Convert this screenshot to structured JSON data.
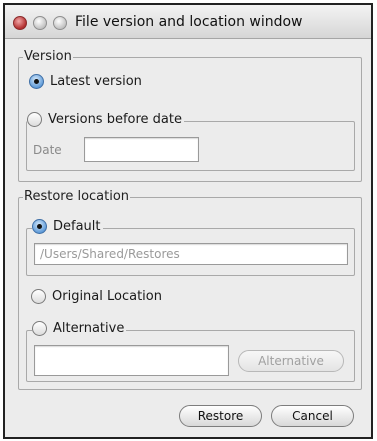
{
  "window": {
    "title": "File version and location window"
  },
  "version": {
    "legend": "Version",
    "latest_label": "Latest version",
    "before_date_legend": "Versions before date",
    "date_label": "Date",
    "date_value": "",
    "selected": "latest"
  },
  "restore": {
    "legend": "Restore location",
    "default_legend": "Default",
    "default_path": "/Users/Shared/Restores",
    "original_label": "Original Location",
    "alternative_legend": "Alternative",
    "alternative_value": "",
    "alternative_button": "Alternative",
    "selected": "default"
  },
  "buttons": {
    "restore": "Restore",
    "cancel": "Cancel"
  },
  "colors": {
    "radio_selected": "#5a97d6",
    "close_light": "#b22e2e"
  }
}
